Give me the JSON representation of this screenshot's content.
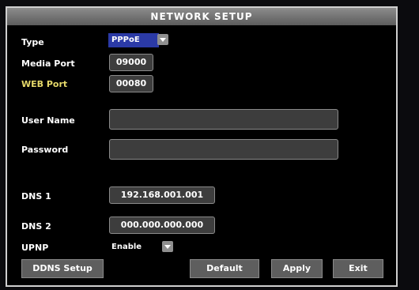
{
  "title": "NETWORK SETUP",
  "fields": {
    "type_label": "Type",
    "type_value": "PPPoE",
    "media_port_label": "Media Port",
    "media_port_value": "09000",
    "web_port_label": "WEB Port",
    "web_port_value": "00080",
    "user_name_label": "User Name",
    "user_name_value": "",
    "password_label": "Password",
    "password_value": "",
    "dns1_label": "DNS 1",
    "dns1_value": "192.168.001.001",
    "dns2_label": "DNS 2",
    "dns2_value": "000.000.000.000",
    "upnp_label": "UPNP",
    "upnp_value": "Enable"
  },
  "buttons": {
    "ddns_setup": "DDNS Setup",
    "default": "Default",
    "apply": "Apply",
    "exit": "Exit"
  },
  "colors": {
    "title_bg": "#6f6f6f",
    "type_select_bg": "#2b3aa6",
    "web_label": "#e6d96a"
  }
}
